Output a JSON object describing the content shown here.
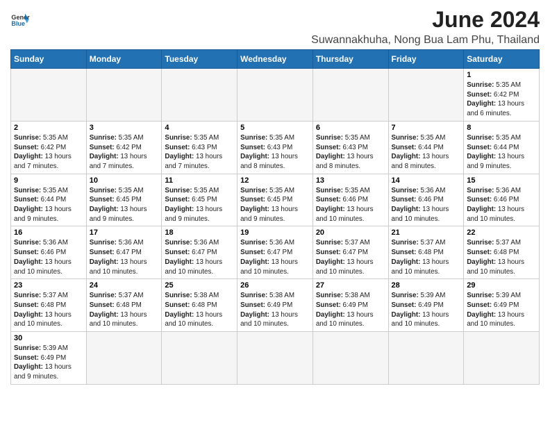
{
  "header": {
    "logo_line1": "General",
    "logo_line2": "Blue",
    "title": "June 2024",
    "subtitle": "Suwannakhuha, Nong Bua Lam Phu, Thailand"
  },
  "weekdays": [
    "Sunday",
    "Monday",
    "Tuesday",
    "Wednesday",
    "Thursday",
    "Friday",
    "Saturday"
  ],
  "weeks": [
    [
      {
        "day": "",
        "empty": true
      },
      {
        "day": "",
        "empty": true
      },
      {
        "day": "",
        "empty": true
      },
      {
        "day": "",
        "empty": true
      },
      {
        "day": "",
        "empty": true
      },
      {
        "day": "",
        "empty": true
      },
      {
        "day": "1",
        "sunrise": "5:35 AM",
        "sunset": "6:42 PM",
        "daylight": "13 hours and 6 minutes."
      }
    ],
    [
      {
        "day": "2",
        "sunrise": "5:35 AM",
        "sunset": "6:42 PM",
        "daylight": "13 hours and 7 minutes."
      },
      {
        "day": "3",
        "sunrise": "5:35 AM",
        "sunset": "6:42 PM",
        "daylight": "13 hours and 7 minutes."
      },
      {
        "day": "4",
        "sunrise": "5:35 AM",
        "sunset": "6:43 PM",
        "daylight": "13 hours and 7 minutes."
      },
      {
        "day": "5",
        "sunrise": "5:35 AM",
        "sunset": "6:43 PM",
        "daylight": "13 hours and 8 minutes."
      },
      {
        "day": "6",
        "sunrise": "5:35 AM",
        "sunset": "6:43 PM",
        "daylight": "13 hours and 8 minutes."
      },
      {
        "day": "7",
        "sunrise": "5:35 AM",
        "sunset": "6:44 PM",
        "daylight": "13 hours and 8 minutes."
      },
      {
        "day": "8",
        "sunrise": "5:35 AM",
        "sunset": "6:44 PM",
        "daylight": "13 hours and 9 minutes."
      }
    ],
    [
      {
        "day": "9",
        "sunrise": "5:35 AM",
        "sunset": "6:44 PM",
        "daylight": "13 hours and 9 minutes."
      },
      {
        "day": "10",
        "sunrise": "5:35 AM",
        "sunset": "6:45 PM",
        "daylight": "13 hours and 9 minutes."
      },
      {
        "day": "11",
        "sunrise": "5:35 AM",
        "sunset": "6:45 PM",
        "daylight": "13 hours and 9 minutes."
      },
      {
        "day": "12",
        "sunrise": "5:35 AM",
        "sunset": "6:45 PM",
        "daylight": "13 hours and 9 minutes."
      },
      {
        "day": "13",
        "sunrise": "5:35 AM",
        "sunset": "6:46 PM",
        "daylight": "13 hours and 10 minutes."
      },
      {
        "day": "14",
        "sunrise": "5:36 AM",
        "sunset": "6:46 PM",
        "daylight": "13 hours and 10 minutes."
      },
      {
        "day": "15",
        "sunrise": "5:36 AM",
        "sunset": "6:46 PM",
        "daylight": "13 hours and 10 minutes."
      }
    ],
    [
      {
        "day": "16",
        "sunrise": "5:36 AM",
        "sunset": "6:46 PM",
        "daylight": "13 hours and 10 minutes."
      },
      {
        "day": "17",
        "sunrise": "5:36 AM",
        "sunset": "6:47 PM",
        "daylight": "13 hours and 10 minutes."
      },
      {
        "day": "18",
        "sunrise": "5:36 AM",
        "sunset": "6:47 PM",
        "daylight": "13 hours and 10 minutes."
      },
      {
        "day": "19",
        "sunrise": "5:36 AM",
        "sunset": "6:47 PM",
        "daylight": "13 hours and 10 minutes."
      },
      {
        "day": "20",
        "sunrise": "5:37 AM",
        "sunset": "6:47 PM",
        "daylight": "13 hours and 10 minutes."
      },
      {
        "day": "21",
        "sunrise": "5:37 AM",
        "sunset": "6:48 PM",
        "daylight": "13 hours and 10 minutes."
      },
      {
        "day": "22",
        "sunrise": "5:37 AM",
        "sunset": "6:48 PM",
        "daylight": "13 hours and 10 minutes."
      }
    ],
    [
      {
        "day": "23",
        "sunrise": "5:37 AM",
        "sunset": "6:48 PM",
        "daylight": "13 hours and 10 minutes."
      },
      {
        "day": "24",
        "sunrise": "5:37 AM",
        "sunset": "6:48 PM",
        "daylight": "13 hours and 10 minutes."
      },
      {
        "day": "25",
        "sunrise": "5:38 AM",
        "sunset": "6:48 PM",
        "daylight": "13 hours and 10 minutes."
      },
      {
        "day": "26",
        "sunrise": "5:38 AM",
        "sunset": "6:49 PM",
        "daylight": "13 hours and 10 minutes."
      },
      {
        "day": "27",
        "sunrise": "5:38 AM",
        "sunset": "6:49 PM",
        "daylight": "13 hours and 10 minutes."
      },
      {
        "day": "28",
        "sunrise": "5:39 AM",
        "sunset": "6:49 PM",
        "daylight": "13 hours and 10 minutes."
      },
      {
        "day": "29",
        "sunrise": "5:39 AM",
        "sunset": "6:49 PM",
        "daylight": "13 hours and 10 minutes."
      }
    ],
    [
      {
        "day": "30",
        "sunrise": "5:39 AM",
        "sunset": "6:49 PM",
        "daylight": "13 hours and 9 minutes."
      },
      {
        "day": "",
        "empty": true
      },
      {
        "day": "",
        "empty": true
      },
      {
        "day": "",
        "empty": true
      },
      {
        "day": "",
        "empty": true
      },
      {
        "day": "",
        "empty": true
      },
      {
        "day": "",
        "empty": true
      }
    ]
  ],
  "labels": {
    "sunrise": "Sunrise:",
    "sunset": "Sunset:",
    "daylight": "Daylight:"
  }
}
